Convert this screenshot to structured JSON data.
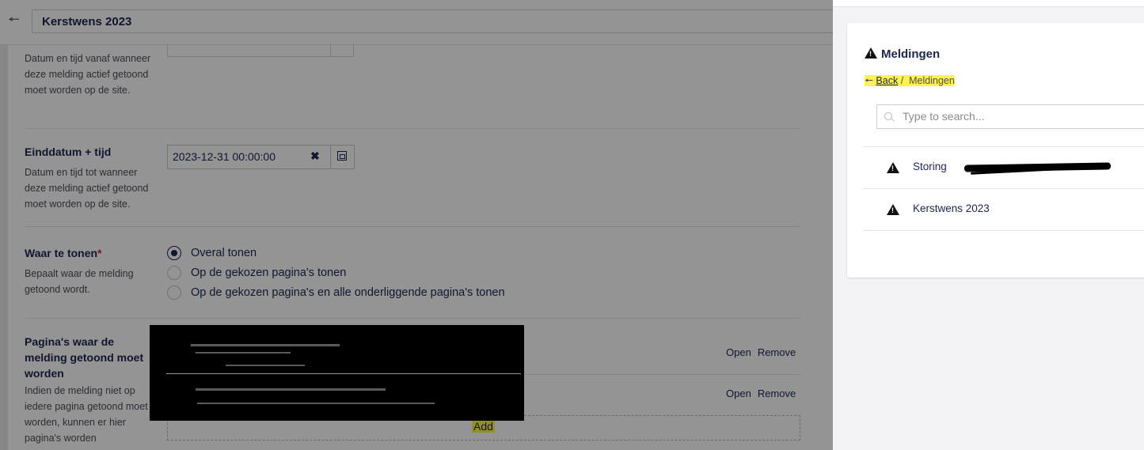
{
  "editor": {
    "title": "Kerstwens 2023",
    "properties": {
      "start_desc": "Datum en tijd vanaf wanneer deze melding actief getoond moet worden op de site.",
      "end_label": "Einddatum + tijd",
      "end_desc": "Datum en tijd tot wanneer deze melding actief getoond moet worden op de site.",
      "end_value": "2023-12-31 00:00:00",
      "clear_glyph": "✖",
      "where_label": "Waar te tonen",
      "required_mark": "*",
      "where_desc": "Bepaalt waar de melding getoond wordt.",
      "where_options": [
        "Overal tonen",
        "Op de gekozen pagina's tonen",
        "Op de gekozen pagina's en alle onderliggende pagina's tonen"
      ],
      "where_selected_index": 0,
      "pages_label": "Pagina's waar de melding getoond moet worden",
      "pages_desc": "Indien de melding niet op iedere pagina getoond moet worden, kunnen er hier pagina's worden",
      "open_label": "Open",
      "remove_label": "Remove",
      "add_label": "Add"
    }
  },
  "panel": {
    "title": "Meldingen",
    "breadcrumb": {
      "back": "Back",
      "separator": "/",
      "current": "Meldingen"
    },
    "search_placeholder": "Type to search...",
    "items": [
      {
        "label": "Storing"
      },
      {
        "label": "Kerstwens 2023"
      }
    ]
  },
  "colors": {
    "text": "#1b264f",
    "highlight": "#fff44f",
    "overlay": "rgba(0,0,0,0.42)"
  }
}
